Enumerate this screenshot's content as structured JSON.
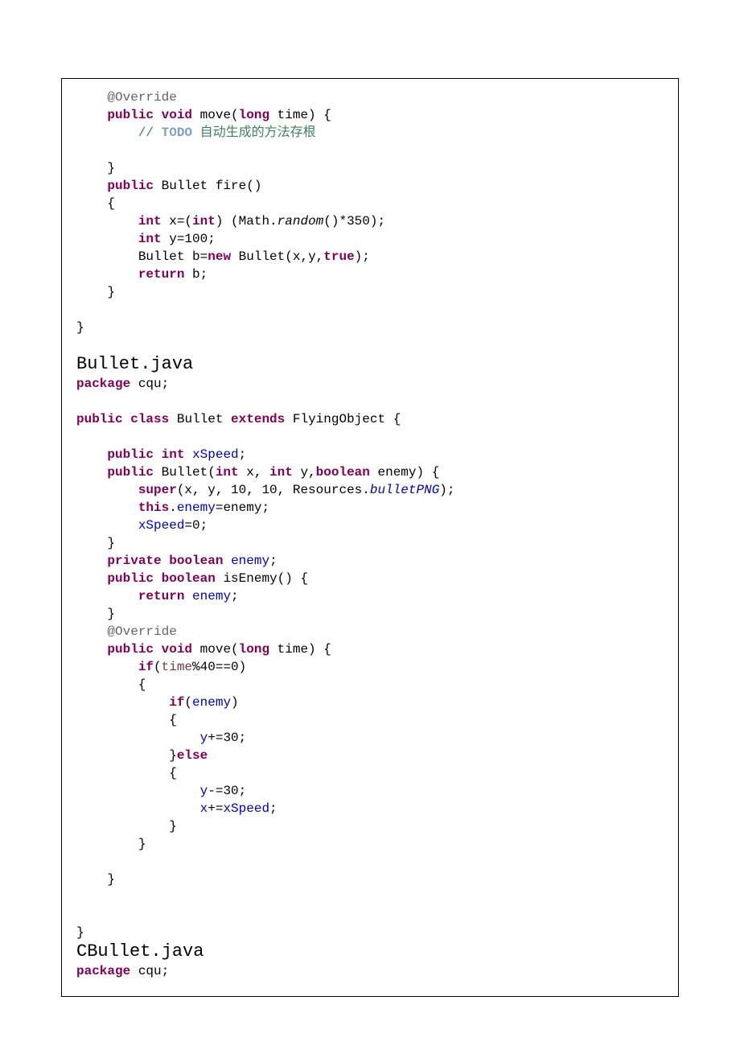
{
  "code": {
    "l1": "    @Override",
    "l2a": "    ",
    "l2b": "public",
    "l2c": " ",
    "l2d": "void",
    "l2e": " move(",
    "l2f": "long",
    "l2g": " time) {",
    "l3a": "        ",
    "l3b": "// ",
    "l3c": "TODO",
    "l3d": " 自动生成的方法存根",
    "l5": "    }",
    "l6a": "    ",
    "l6b": "public",
    "l6c": " Bullet fire()",
    "l7": "    {",
    "l8a": "        ",
    "l8b": "int",
    "l8c": " x=(",
    "l8d": "int",
    "l8e": ") (Math.",
    "l8f": "random",
    "l8g": "()*350);",
    "l9a": "        ",
    "l9b": "int",
    "l9c": " y=100;",
    "l10a": "        Bullet b=",
    "l10b": "new",
    "l10c": " Bullet(x,y,",
    "l10d": "true",
    "l10e": ");",
    "l11a": "        ",
    "l11b": "return",
    "l11c": " b;",
    "l12": "    }",
    "l14": "}",
    "h1": "Bullet.java",
    "p1a": "package",
    "p1b": " cqu;",
    "c1a": "public",
    "c1b": " ",
    "c1c": "class",
    "c1d": " Bullet ",
    "c1e": "extends",
    "c1f": " FlyingObject {",
    "f1a": "    ",
    "f1b": "public",
    "f1c": " ",
    "f1d": "int",
    "f1e": " ",
    "f1f": "xSpeed",
    "f1g": ";",
    "con1a": "    ",
    "con1b": "public",
    "con1c": " Bullet(",
    "con1d": "int",
    "con1e": " x, ",
    "con1f": "int",
    "con1g": " y,",
    "con1h": "boolean",
    "con1i": " enemy) {",
    "s1a": "        ",
    "s1b": "super",
    "s1c": "(x, y, 10, 10, Resources.",
    "s1d": "bulletPNG",
    "s1e": ");",
    "t1a": "        ",
    "t1b": "this",
    "t1c": ".",
    "t1d": "enemy",
    "t1e": "=enemy;",
    "xs1a": "        ",
    "xs1b": "xSpeed",
    "xs1c": "=0;",
    "cb1": "    }",
    "pf1a": "    ",
    "pf1b": "private",
    "pf1c": " ",
    "pf1d": "boolean",
    "pf1e": " ",
    "pf1f": "enemy",
    "pf1g": ";",
    "ie1a": "    ",
    "ie1b": "public",
    "ie1c": " ",
    "ie1d": "boolean",
    "ie1e": " isEnemy() {",
    "re1a": "        ",
    "re1b": "return",
    "re1c": " ",
    "re1d": "enemy",
    "re1e": ";",
    "cb2": "    }",
    "ov2a": "    ",
    "ov2b": "@Override",
    "mv1a": "    ",
    "mv1b": "public",
    "mv1c": " ",
    "mv1d": "void",
    "mv1e": " move(",
    "mv1f": "long",
    "mv1g": " time) {",
    "if1a": "        ",
    "if1b": "if",
    "if1c": "(",
    "if1d": "time",
    "if1e": "%40==0)",
    "ob1": "        {",
    "if2a": "            ",
    "if2b": "if",
    "if2c": "(",
    "if2d": "enemy",
    "if2e": ")",
    "ob2": "            {",
    "yp1a": "                ",
    "yp1b": "y",
    "yp1c": "+=30;",
    "el1a": "            }",
    "el1b": "else",
    "ob3": "            {",
    "ym1a": "                ",
    "ym1b": "y",
    "ym1c": "-=30;",
    "xp1a": "                ",
    "xp1b": "x",
    "xp1c": "+=",
    "xp1d": "xSpeed",
    "xp1e": ";",
    "cb3": "            }",
    "cb4": "        }",
    "cb5": "    }",
    "cb6": "}",
    "h2": "CBullet.java",
    "p2a": "package",
    "p2b": " cqu;"
  }
}
